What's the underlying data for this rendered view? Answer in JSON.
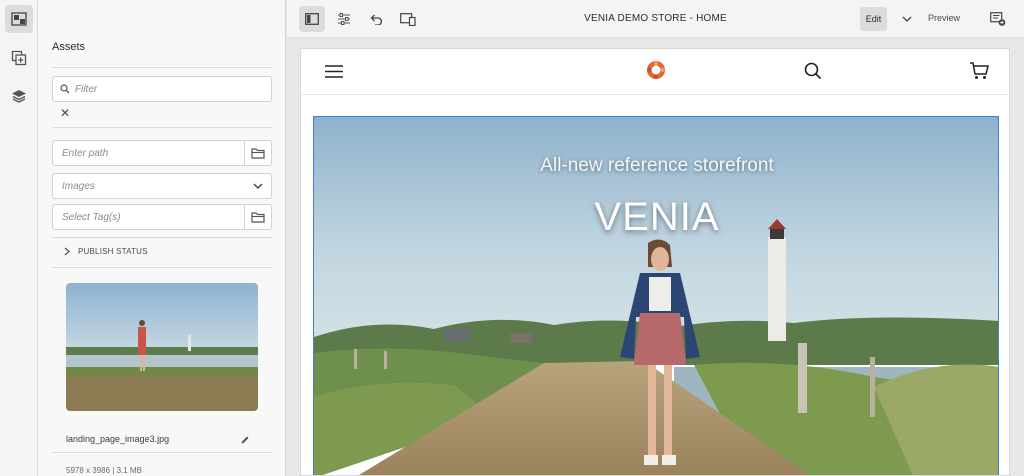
{
  "rail": {
    "items": [
      {
        "icon": "asset-finder-icon",
        "active": true
      },
      {
        "icon": "components-icon",
        "active": false
      },
      {
        "icon": "layers-icon",
        "active": false
      }
    ]
  },
  "panel": {
    "title": "Assets",
    "filter_placeholder": "Filter",
    "clear_symbol": "✕",
    "path_placeholder": "Enter path",
    "asset_type_value": "Images",
    "tags_placeholder": "Select Tag(s)",
    "publish_status_label": "PUBLISH STATUS",
    "asset": {
      "name": "landing_page_image3.jpg",
      "meta": "5978 x 3986 | 3.1 MB"
    }
  },
  "toolbar": {
    "page_title": "VENIA DEMO STORE - HOME",
    "edit_label": "Edit",
    "preview_label": "Preview"
  },
  "site": {
    "hero_subtitle": "All-new reference storefront",
    "hero_title": "VENIA"
  },
  "colors": {
    "accent_selection": "#3d7fd1",
    "logo": "#e0643a"
  }
}
